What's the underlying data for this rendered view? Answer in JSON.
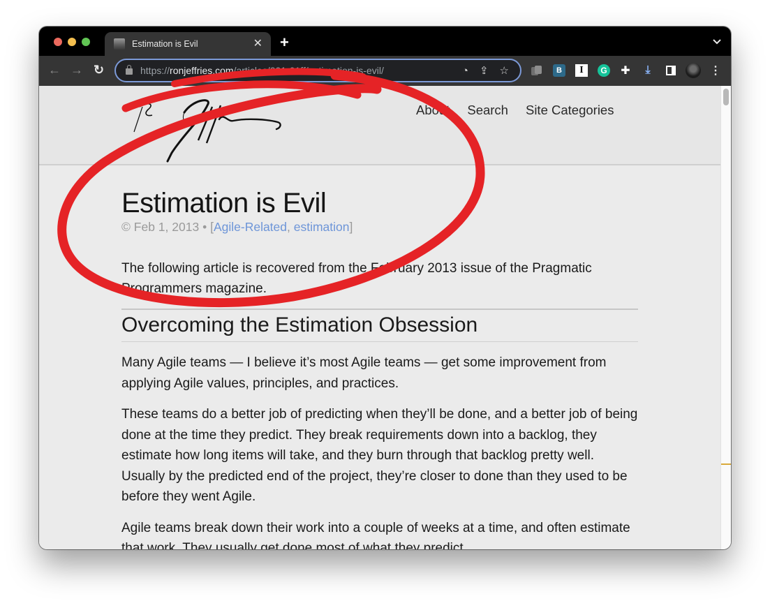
{
  "browser": {
    "tab": {
      "title": "Estimation is Evil",
      "favicon": "author-portrait-favicon",
      "close_glyph": "✕"
    },
    "new_tab_glyph": "+",
    "tab_menu_glyph": "⌄",
    "nav": {
      "back_glyph": "←",
      "forward_glyph": "→",
      "reload_glyph": "↻"
    },
    "address": {
      "scheme": "https://",
      "host": "ronjeffries.com",
      "path": "/articles/001-01ff/estimation-is-evil/"
    },
    "omnibox_icons": [
      {
        "name": "performance-icon",
        "glyph": "◔"
      },
      {
        "name": "share-icon",
        "glyph": "⇪"
      },
      {
        "name": "bookmark-star-icon",
        "glyph": "☆"
      }
    ],
    "extensions": [
      {
        "name": "copies-extension-icon",
        "glyph": ""
      },
      {
        "name": "b-extension-icon",
        "glyph": "B"
      },
      {
        "name": "instapaper-extension-icon",
        "glyph": "I"
      },
      {
        "name": "grammarly-extension-icon",
        "glyph": "G"
      },
      {
        "name": "extensions-puzzle-icon",
        "glyph": "✚"
      },
      {
        "name": "download-icon",
        "glyph": "⤓"
      },
      {
        "name": "side-panel-icon",
        "glyph": ""
      },
      {
        "name": "profile-avatar",
        "glyph": ""
      },
      {
        "name": "chrome-menu-icon",
        "glyph": "⋮"
      }
    ]
  },
  "site": {
    "logo": "Ron Jeffries signature",
    "nav": [
      {
        "label": "About"
      },
      {
        "label": "Search"
      },
      {
        "label": "Site Categories"
      }
    ]
  },
  "article": {
    "title": "Estimation is Evil",
    "meta": {
      "copyright": "©",
      "date": "Feb 1, 2013",
      "separator": "•",
      "open_bracket": "[",
      "categories": [
        "Agile-Related",
        "estimation"
      ],
      "close_bracket": "]"
    },
    "intro": "The following article is recovered from the February 2013 issue of the Pragmatic Programmers magazine.",
    "section_heading": "Overcoming the Estimation Obsession",
    "paragraphs": [
      "Many Agile teams — I believe it’s most Agile teams — get some improvement from applying Agile values, principles, and practices.",
      "These teams do a better job of predicting when they’ll be done, and a better job of being done at the time they predict. They break requirements down into a backlog, they estimate how long items will take, and they burn through that backlog pretty well. Usually by the predicted end of the project, they’re closer to done than they used to be before they went Agile.",
      "Agile teams break down their work into a couple of weeks at a time, and often estimate that work. They usually get done most of what they predict"
    ]
  },
  "annotation": {
    "type": "hand-drawn circle",
    "color": "#e52326",
    "target": "article title and meta"
  },
  "colors": {
    "link": "#6d95d8",
    "meta": "#9a9a9a",
    "omnibox_focus": "#7c9ad8",
    "scroll_marker": "#d9a93a"
  }
}
